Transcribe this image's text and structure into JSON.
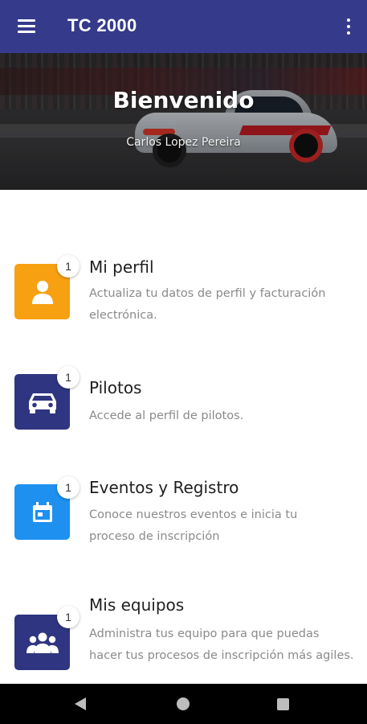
{
  "app_bar": {
    "title": "TC 2000",
    "menu_icon": "hamburger-menu-icon",
    "overflow_icon": "more-vert-icon",
    "color": "#353a8a"
  },
  "hero": {
    "title": "Bienvenido",
    "user_name": "Carlos Lopez Pereira"
  },
  "menu_items": [
    {
      "title": "Mi perfil",
      "badge": "1",
      "description": "Actualiza tu datos de perfil y facturación electrónica.",
      "icon": "person-icon",
      "color": "#f7a012"
    },
    {
      "title": "Pilotos",
      "badge": "1",
      "description": "Accede al perfil de pilotos.",
      "icon": "car-icon",
      "color": "#2f3580"
    },
    {
      "title": "Eventos y Registro",
      "badge": "1",
      "description": "Conoce nuestros eventos e inicia tu proceso de inscripción",
      "icon": "calendar-icon",
      "color": "#1e90f0"
    },
    {
      "title": "Mis equipos",
      "badge": "1",
      "description": "Administra tus equipo para que puedas hacer tus procesos de inscripción más agiles.",
      "icon": "group-icon",
      "color": "#2f3580"
    }
  ],
  "system_nav": {
    "back_icon": "back-icon",
    "home_icon": "home-icon",
    "recents_icon": "recents-icon"
  }
}
